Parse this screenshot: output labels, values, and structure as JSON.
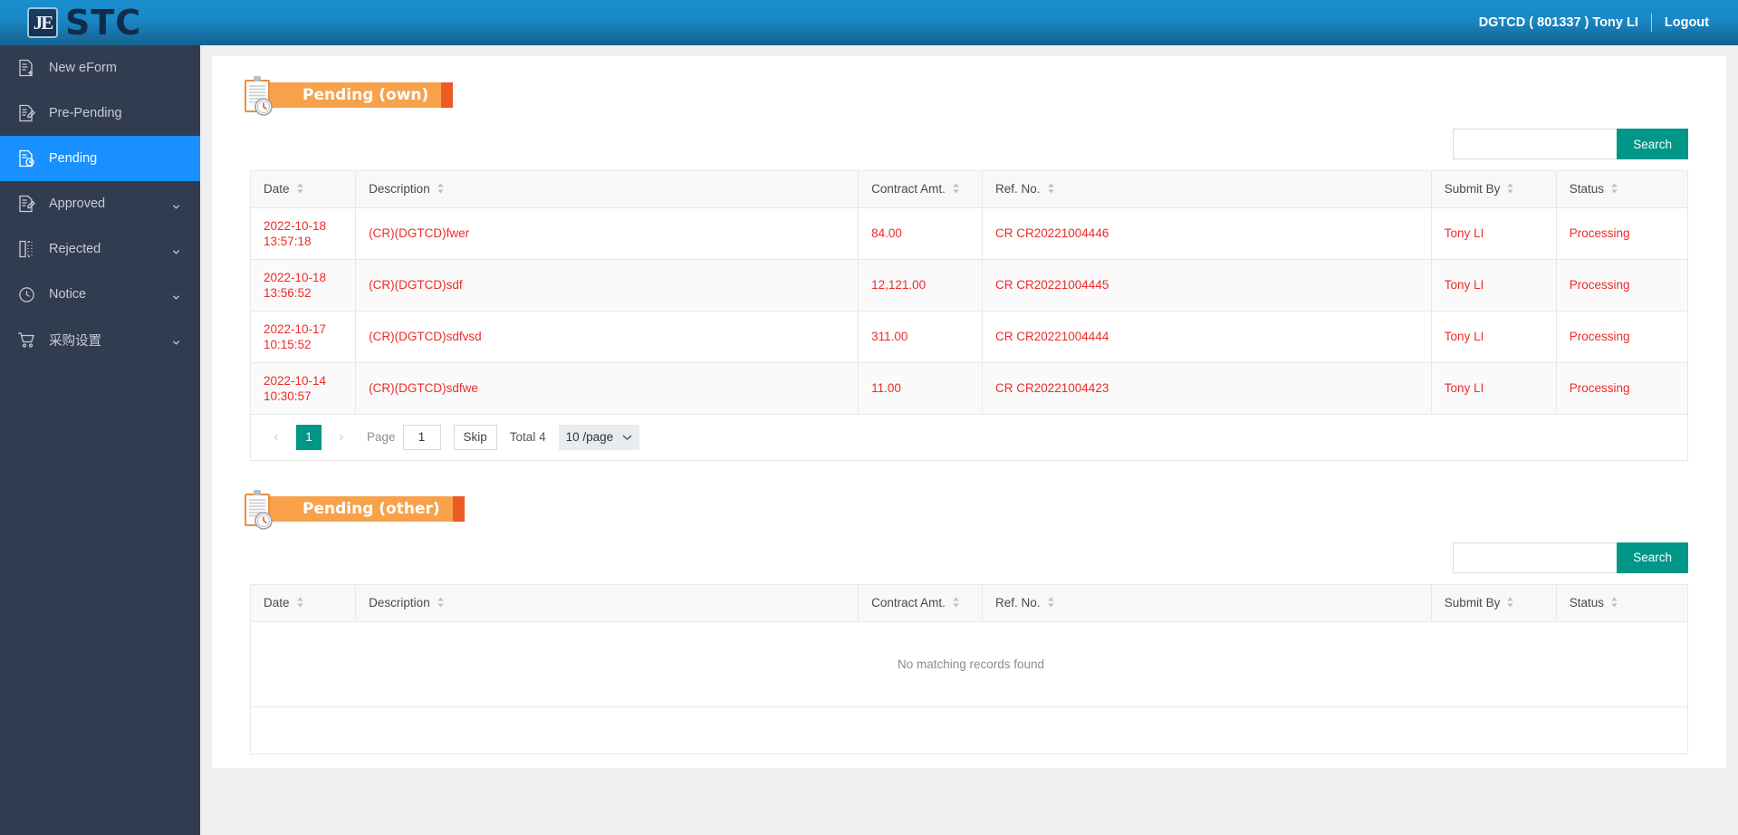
{
  "header": {
    "logo_mark": "JE",
    "logo_text": "STC",
    "user": "DGTCD ( 801337 ) Tony LI",
    "logout": "Logout"
  },
  "sidebar": {
    "items": [
      {
        "label": "New eForm",
        "icon": "document-add-icon",
        "active": false,
        "caret": false
      },
      {
        "label": "Pre-Pending",
        "icon": "document-edit-icon",
        "active": false,
        "caret": false
      },
      {
        "label": "Pending",
        "icon": "document-clock-icon",
        "active": true,
        "caret": false
      },
      {
        "label": "Approved",
        "icon": "document-check-icon",
        "active": false,
        "caret": true
      },
      {
        "label": "Rejected",
        "icon": "document-dashed-icon",
        "active": false,
        "caret": true
      },
      {
        "label": "Notice",
        "icon": "clock-icon",
        "active": false,
        "caret": true
      },
      {
        "label": "采购设置",
        "icon": "cart-icon",
        "active": false,
        "caret": true
      }
    ]
  },
  "colors": {
    "accent_teal": "#009688",
    "banner_orange": "#f7a24b",
    "banner_accent": "#ec5b24",
    "active_blue": "#1890ff",
    "row_text_red": "#ee2b28",
    "status_blue": "#2682e8"
  },
  "sections": [
    {
      "title": "Pending (own)",
      "search": {
        "value": "",
        "placeholder": "",
        "button_label": "Search"
      },
      "columns": [
        {
          "label": "Date",
          "sortable": true
        },
        {
          "label": "Description",
          "sortable": true
        },
        {
          "label": "Contract Amt.",
          "sortable": true
        },
        {
          "label": "Ref. No.",
          "sortable": true
        },
        {
          "label": "Submit By",
          "sortable": true
        },
        {
          "label": "Status",
          "sortable": true
        }
      ],
      "rows": [
        {
          "date": "2022-10-18",
          "time": "13:57:18",
          "description": "(CR)(DGTCD)fwer",
          "amount": "84.00",
          "ref": "CR CR20221004446",
          "submit_by": "Tony LI",
          "status": "Processing"
        },
        {
          "date": "2022-10-18",
          "time": "13:56:52",
          "description": "(CR)(DGTCD)sdf",
          "amount": "12,121.00",
          "ref": "CR CR20221004445",
          "submit_by": "Tony LI",
          "status": "Processing"
        },
        {
          "date": "2022-10-17",
          "time": "10:15:52",
          "description": "(CR)(DGTCD)sdfvsd",
          "amount": "311.00",
          "ref": "CR CR20221004444",
          "submit_by": "Tony LI",
          "status": "Processing"
        },
        {
          "date": "2022-10-14",
          "time": "10:30:57",
          "description": "(CR)(DGTCD)sdfwe",
          "amount": "11.00",
          "ref": "CR CR20221004423",
          "submit_by": "Tony LI",
          "status": "Processing"
        }
      ],
      "pager": {
        "prev": "‹",
        "next": "›",
        "current_page": "1",
        "page_label": "Page",
        "page_input_value": "1",
        "skip_label": "Skip",
        "total_label": "Total 4",
        "page_size": "10 /page"
      }
    },
    {
      "title": "Pending (other)",
      "search": {
        "value": "",
        "placeholder": "",
        "button_label": "Search"
      },
      "columns": [
        {
          "label": "Date",
          "sortable": true
        },
        {
          "label": "Description",
          "sortable": true
        },
        {
          "label": "Contract Amt.",
          "sortable": true
        },
        {
          "label": "Ref. No.",
          "sortable": true
        },
        {
          "label": "Submit By",
          "sortable": true
        },
        {
          "label": "Status",
          "sortable": true
        }
      ],
      "rows": [],
      "empty_message": "No matching records found"
    }
  ]
}
